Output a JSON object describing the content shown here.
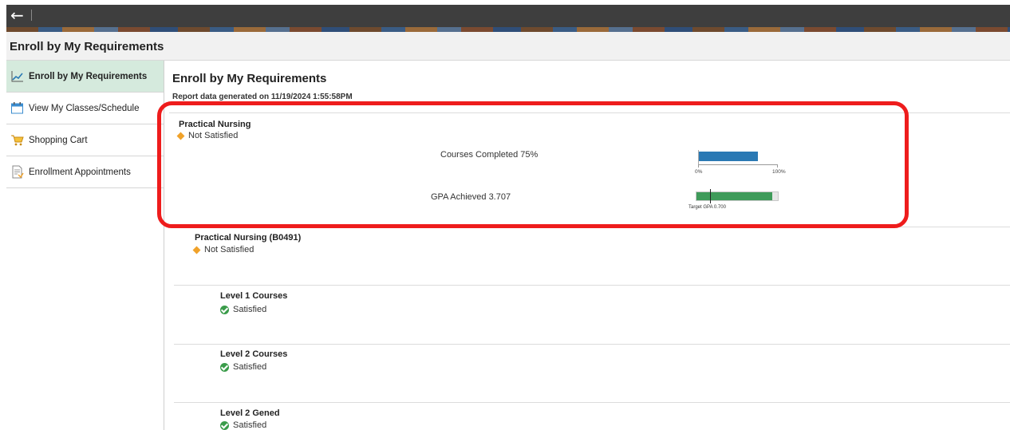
{
  "topbar": {
    "back_glyph": "←",
    "back_icon": "back-arrow-icon"
  },
  "header": {
    "title": "Enroll by My Requirements"
  },
  "sidebar": {
    "items": [
      {
        "label": "Enroll by My Requirements",
        "icon": "chart-line-icon",
        "active": true
      },
      {
        "label": "View My Classes/Schedule",
        "icon": "calendar-icon",
        "active": false
      },
      {
        "label": "Shopping Cart",
        "icon": "shopping-cart-icon",
        "active": false
      },
      {
        "label": "Enrollment Appointments",
        "icon": "appointment-document-icon",
        "active": false
      }
    ]
  },
  "main": {
    "title": "Enroll by My Requirements",
    "report_date": "Report data generated on 11/19/2024 1:55:58PM",
    "program": {
      "name": "Practical Nursing",
      "status": "Not Satisfied",
      "courses_completed_label": "Courses Completed 75%",
      "courses_completed_pct": 75,
      "scale_min_label": "0%",
      "scale_max_label": "100%",
      "gpa_label": "GPA Achieved  3.707",
      "gpa_achieved": 3.707,
      "gpa_scale_max": 4.0,
      "target_gpa_label": "Target GPA 0.700",
      "target_gpa": 0.7
    },
    "requirements": [
      {
        "title": "Practical Nursing (B0491)",
        "status": "Not Satisfied"
      },
      {
        "title": "Level 1 Courses",
        "status": "Satisfied"
      },
      {
        "title": "Level 2 Courses",
        "status": "Satisfied"
      },
      {
        "title": "Level 2 Gened",
        "status": "Satisfied"
      }
    ]
  },
  "colors": {
    "courses_bar": "#2a79b4",
    "gpa_bar": "#3f9b5a",
    "not_satisfied": "#f0a22a",
    "satisfied": "#3a9c4a",
    "highlight": "#ee1c1c",
    "active_nav": "#d5eadd"
  }
}
